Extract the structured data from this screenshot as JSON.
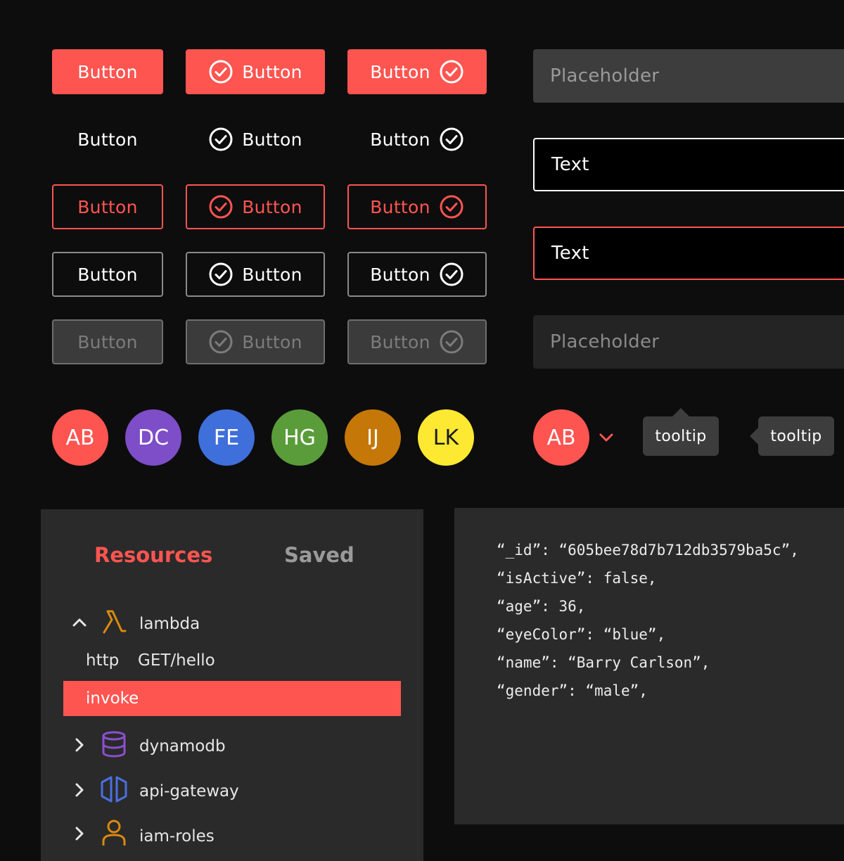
{
  "buttons": {
    "label": "Button",
    "rows": [
      "solid",
      "ghost",
      "outline-red",
      "outline-gray",
      "disabled"
    ]
  },
  "inputs": [
    {
      "state": "placeholder",
      "placeholder": "Placeholder",
      "value": ""
    },
    {
      "state": "filled",
      "placeholder": "",
      "value": "Text"
    },
    {
      "state": "error",
      "placeholder": "",
      "value": "Text"
    },
    {
      "state": "disabled",
      "placeholder": "Placeholder",
      "value": ""
    }
  ],
  "avatars": [
    {
      "initials": "AB",
      "color": "#fe5551",
      "text_color": "#ffffff"
    },
    {
      "initials": "DC",
      "color": "#7e4dc8",
      "text_color": "#ffffff"
    },
    {
      "initials": "FE",
      "color": "#3f6fda",
      "text_color": "#ffffff"
    },
    {
      "initials": "HG",
      "color": "#5a9c3a",
      "text_color": "#ffffff"
    },
    {
      "initials": "IJ",
      "color": "#c57708",
      "text_color": "#ffffff"
    },
    {
      "initials": "LK",
      "color": "#fde932",
      "text_color": "#1a1a1a"
    }
  ],
  "avatar_dropdown": {
    "initials": "AB",
    "color": "#fe5551",
    "icon": "chevron-down-icon"
  },
  "tooltips": [
    {
      "text": "tooltip",
      "arrow": "top"
    },
    {
      "text": "tooltip",
      "arrow": "left"
    }
  ],
  "resources": {
    "tabs": [
      {
        "label": "Resources",
        "active": true
      },
      {
        "label": "Saved",
        "active": false
      }
    ],
    "tree": [
      {
        "name": "lambda",
        "icon": "lambda-icon",
        "expanded": true,
        "icon_color": "#d98a10"
      },
      {
        "name": "dynamodb",
        "icon": "database-icon",
        "expanded": false,
        "icon_color": "#8c4fd1"
      },
      {
        "name": "api-gateway",
        "icon": "api-gateway-icon",
        "expanded": false,
        "icon_color": "#4a6fe0"
      },
      {
        "name": "iam-roles",
        "icon": "user-icon",
        "expanded": false,
        "icon_color": "#d98a10"
      }
    ],
    "lambda_children": {
      "http_label": "http",
      "route": "GET/hello",
      "selected": "invoke"
    }
  },
  "json_lines": [
    "“_id”: “605bee78d7b712db3579ba5c”,",
    "“isActive”: false,",
    "“age”: 36,",
    "“eyeColor”: “blue”,",
    "“name”: “Barry Carlson”,",
    "“gender”: “male”,"
  ],
  "colors": {
    "accent": "#fe5551",
    "background": "#0d0d0d",
    "panel": "#2a2a2a"
  }
}
